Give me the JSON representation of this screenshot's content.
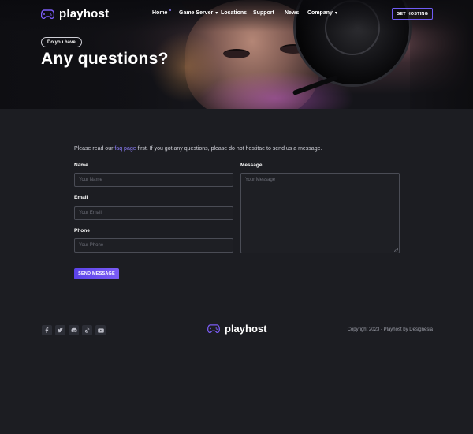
{
  "brand": {
    "name": "playhost",
    "accent": "#7b5cf5"
  },
  "nav": {
    "items": [
      {
        "label": "Home",
        "has_dot": true,
        "has_caret": false
      },
      {
        "label": "Game Server",
        "has_dot": false,
        "has_caret": true
      },
      {
        "label": "Locations",
        "has_dot": false,
        "has_caret": false
      },
      {
        "label": "Support",
        "has_dot": false,
        "has_caret": false
      },
      {
        "label": "News",
        "has_dot": false,
        "has_caret": false
      },
      {
        "label": "Company",
        "has_dot": false,
        "has_caret": true
      }
    ],
    "cta_label": "GET HOSTING"
  },
  "hero": {
    "badge": "Do you have",
    "title": "Any questions?"
  },
  "contact": {
    "intro_before": "Please read our ",
    "intro_link": "faq page",
    "intro_after": " first. If you got any questions, please do not hestitae to send us a message.",
    "name_label": "Name",
    "name_placeholder": "Your Name",
    "email_label": "Email",
    "email_placeholder": "Your Email",
    "phone_label": "Phone",
    "phone_placeholder": "Your Phone",
    "message_label": "Message",
    "message_placeholder": "Your Message",
    "send_label": "SEND MESSAGE"
  },
  "footer": {
    "socials": [
      "facebook-icon",
      "twitter-icon",
      "discord-icon",
      "tiktok-icon",
      "youtube-icon"
    ],
    "brand": "playhost",
    "copyright": "Copyright 2023 - Playhost by Designesia"
  }
}
